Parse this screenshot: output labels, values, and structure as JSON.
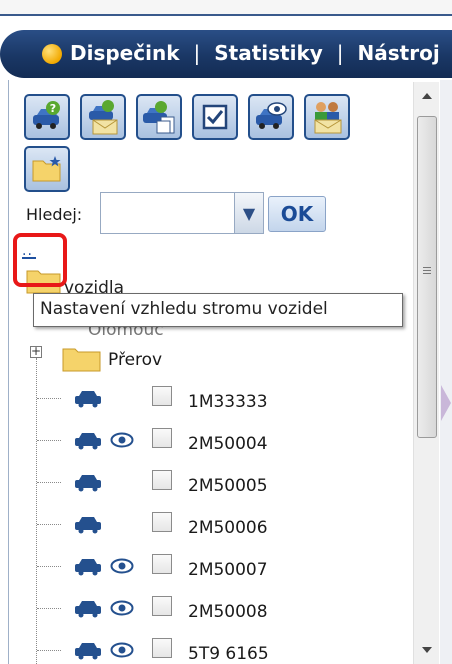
{
  "menu": {
    "items": [
      "Dispečink",
      "Statistiky",
      "Nástroj"
    ],
    "separator": "|"
  },
  "toolbar": {
    "buttons": [
      {
        "icon": "car-question-icon"
      },
      {
        "icon": "car-question-mail-icon"
      },
      {
        "icon": "car-question-copy-icon"
      },
      {
        "icon": "checkbox-icon"
      },
      {
        "icon": "car-eye-icon"
      },
      {
        "icon": "people-mail-icon"
      },
      {
        "icon": "folder-star-icon"
      }
    ]
  },
  "search": {
    "label": "Hledej:",
    "value": "",
    "ok_label": "OK"
  },
  "tree": {
    "settings_icon_glyph": "..",
    "root_label": "vozidla",
    "tooltip": "Nastavení vzhledu stromu vozidel",
    "hidden_branch": "Olomouc",
    "branch_label": "Přerov",
    "expand_glyph": "+",
    "vehicles": [
      {
        "label": "1M33333",
        "watched": false
      },
      {
        "label": "2M50004",
        "watched": true
      },
      {
        "label": "2M50005",
        "watched": false
      },
      {
        "label": "2M50006",
        "watched": false
      },
      {
        "label": "2M50007",
        "watched": true
      },
      {
        "label": "2M50008",
        "watched": true
      },
      {
        "label": "5T9 6165",
        "watched": true
      }
    ]
  },
  "colors": {
    "menu_bg": "#1a3765",
    "accent_blue": "#234f8b",
    "highlight_red": "#e81818",
    "folder_yellow": "#f5d36a"
  }
}
